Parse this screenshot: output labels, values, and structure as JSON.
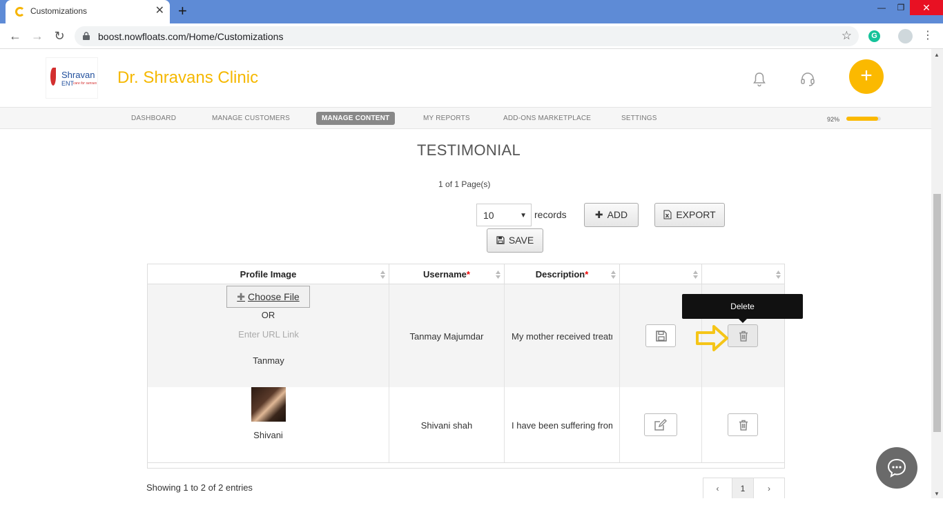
{
  "browser": {
    "tab_title": "Customizations",
    "tab_close": "✕",
    "new_tab": "+",
    "url": "boost.nowfloats.com/Home/Customizations",
    "win_min": "—",
    "win_max": "❐",
    "win_close": "✕",
    "ext_grammarly": "G"
  },
  "header": {
    "logo_name": "Shravan",
    "logo_sub": "ENT",
    "logo_tag": "care for senses",
    "brand_title": "Dr. Shravans Clinic",
    "add_label": "+"
  },
  "nav": {
    "items": [
      {
        "label": "DASHBOARD"
      },
      {
        "label": "MANAGE CUSTOMERS"
      },
      {
        "label": "MANAGE CONTENT"
      },
      {
        "label": "MY REPORTS"
      },
      {
        "label": "ADD-ONS MARKETPLACE"
      },
      {
        "label": "SETTINGS"
      }
    ],
    "active_index": 2,
    "progress_label": "92%",
    "progress_value": 92,
    "accent_color": "#fbb900"
  },
  "section": {
    "title": "TESTIMONIAL",
    "page_current": "1",
    "page_of": " of ",
    "page_total": "1",
    "page_suffix": " Page(s)"
  },
  "controls": {
    "records_value": "10",
    "records_label": "records",
    "add_label": "ADD",
    "export_label": "EXPORT",
    "save_label": "SAVE"
  },
  "table": {
    "headers": [
      {
        "label": "Profile Image",
        "required": false
      },
      {
        "label": "Username",
        "required": true
      },
      {
        "label": "Description",
        "required": true
      },
      {
        "label": "",
        "required": false
      },
      {
        "label": "",
        "required": false
      }
    ],
    "required_mark": "*",
    "edit_row": {
      "choose_file_label": "Choose File",
      "or_label": "OR",
      "url_placeholder": "Enter URL Link",
      "image_name": "Tanmay",
      "username": "Tanmay Majumdar",
      "description": "My mother received treatment"
    },
    "rows": [
      {
        "image_name": "Shivani",
        "username": "Shivani shah",
        "description": "I have been suffering from"
      }
    ]
  },
  "tooltip": {
    "label": "Delete"
  },
  "footer": {
    "entries_info": "Showing 1 to 2 of 2 entries",
    "prev": "‹",
    "page": "1",
    "next": "›"
  }
}
